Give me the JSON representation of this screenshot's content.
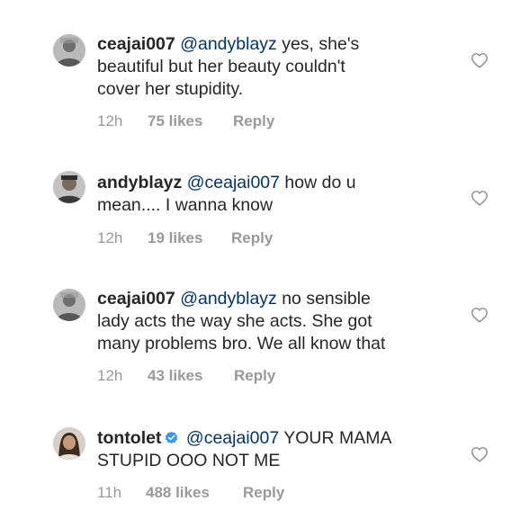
{
  "comments": [
    {
      "username": "ceajai007",
      "mention": "@andyblayz",
      "text_line1": " yes, she's",
      "text_line2": "beautiful but her beauty couldn't",
      "text_line3": "cover her stupidity.",
      "time": "12h",
      "likes": "75 likes",
      "reply": "Reply",
      "verified": false
    },
    {
      "username": "andyblayz",
      "mention": "@ceajai007",
      "text_line1": " how do u",
      "text_line2": "mean.... I wanna know",
      "text_line3": "",
      "time": "12h",
      "likes": "19 likes",
      "reply": "Reply",
      "verified": false
    },
    {
      "username": "ceajai007",
      "mention": "@andyblayz",
      "text_line1": " no sensible",
      "text_line2": "lady acts the way she acts. She got",
      "text_line3": "many problems bro. We all know that",
      "time": "12h",
      "likes": "43 likes",
      "reply": "Reply",
      "verified": false
    },
    {
      "username": "tontolet",
      "mention": "@ceajai007",
      "text_line1": " YOUR MAMA",
      "text_line2": "STUPID OOO NOT ME",
      "text_line3": "",
      "time": "11h",
      "likes": "488 likes",
      "reply": "Reply",
      "verified": true
    }
  ],
  "icons": {
    "like": "heart-outline-icon",
    "verified": "verified-badge-icon"
  },
  "colors": {
    "text": "#262626",
    "mention": "#003569",
    "meta": "#999999",
    "verified": "#3897f0"
  }
}
